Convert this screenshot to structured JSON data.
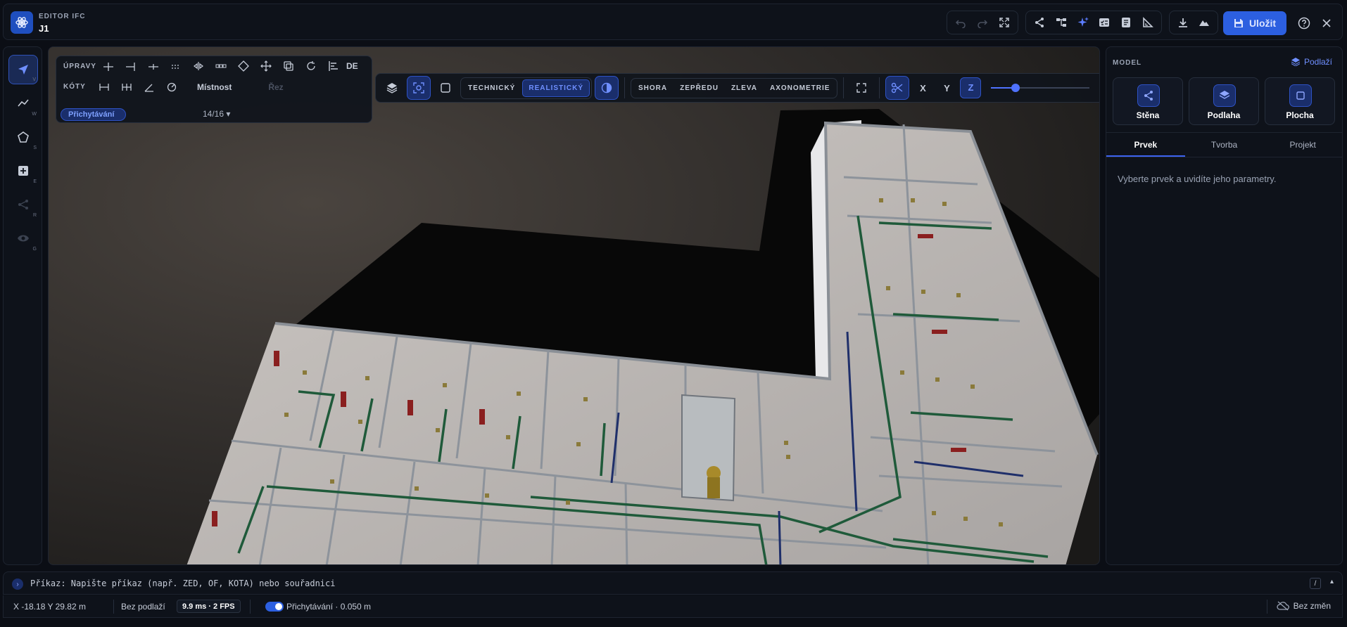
{
  "header": {
    "app_title": "EDITOR IFC",
    "doc_title": "J1",
    "save_label": "Uložit",
    "icons": [
      "undo-icon",
      "redo-icon",
      "fullscreen-icon",
      "share-icon",
      "hierarchy-icon",
      "ai-sparkle-icon",
      "checklist-icon",
      "report-icon",
      "measure-icon",
      "download-icon",
      "terrain-icon"
    ]
  },
  "leftrail": {
    "tools": [
      {
        "name": "select",
        "key": "V"
      },
      {
        "name": "line",
        "key": "W"
      },
      {
        "name": "polygon",
        "key": "S"
      },
      {
        "name": "add-element",
        "key": "E"
      },
      {
        "name": "connect",
        "key": "R"
      },
      {
        "name": "visibility",
        "key": "G"
      }
    ]
  },
  "toolpanel": {
    "edits_label": "ÚPRAVY",
    "dims_label": "KÓTY",
    "de_label": "DE",
    "room_label": "Místnost",
    "section_label": "Řez",
    "snap_label": "Přichytávání",
    "snap_count": "14/16 ▾"
  },
  "viewbar": {
    "modes": [
      "TECHNICKÝ",
      "REALISTICKÝ"
    ],
    "active_mode": "REALISTICKÝ",
    "views": [
      "SHORA",
      "ZEPŘEDU",
      "ZLEVA",
      "AXONOMETRIE"
    ],
    "axes": [
      "X",
      "Y",
      "Z"
    ],
    "active_axis": "Z",
    "clip_level": 0.25
  },
  "rightpanel": {
    "title": "MODEL",
    "floors_label": "Podlaží",
    "cards": [
      "Stěna",
      "Podlaha",
      "Plocha"
    ],
    "tabs": [
      "Prvek",
      "Tvorba",
      "Projekt"
    ],
    "active_tab": "Prvek",
    "hint": "Vyberte prvek a uvidíte jeho parametry."
  },
  "command": {
    "placeholder": "Příkaz: Napište příkaz (např. ZED, OF, KOTA) nebo souřadnici",
    "shortcut": "/",
    "caret": "▴"
  },
  "status": {
    "coords": "X -18.18 Y 29.82 m",
    "floor": "Bez podlaží",
    "perf": "9.9 ms · 2 FPS",
    "snap": "Přichytávání · 0.050 m",
    "changes": "Bez změn"
  },
  "colors": {
    "accent": "#2c5fe0",
    "accent_text": "#6f8fff",
    "background": "#0b0e15"
  }
}
